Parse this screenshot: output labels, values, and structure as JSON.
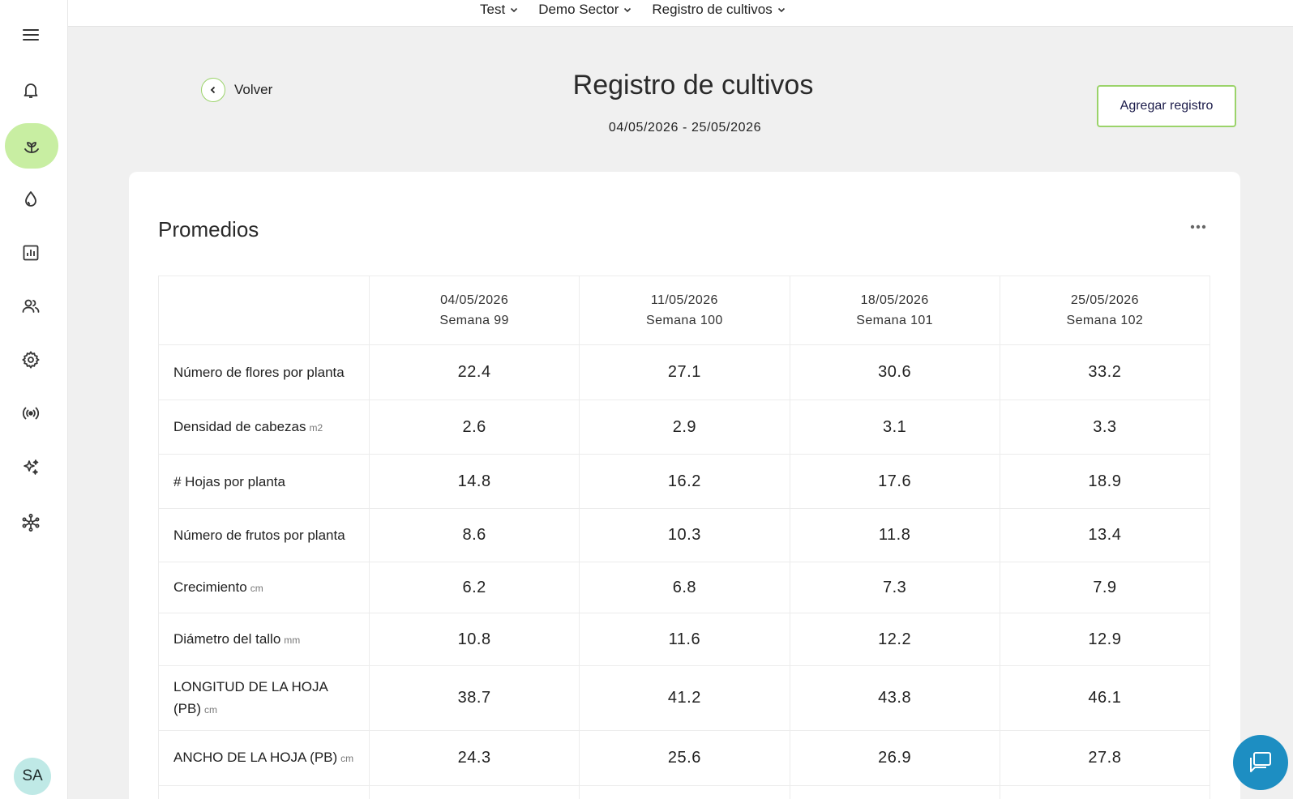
{
  "topbar": {
    "crumbs": [
      {
        "label": "Test"
      },
      {
        "label": "Demo Sector"
      },
      {
        "label": "Registro de cultivos"
      }
    ]
  },
  "sidebar": {
    "items": [
      {
        "icon": "menu-icon"
      },
      {
        "icon": "bell-icon"
      },
      {
        "icon": "plant-icon",
        "active": true
      },
      {
        "icon": "water-drop-icon"
      },
      {
        "icon": "bar-chart-icon"
      },
      {
        "icon": "users-icon"
      },
      {
        "icon": "gear-icon"
      },
      {
        "icon": "signal-icon"
      },
      {
        "icon": "sparkle-icon"
      },
      {
        "icon": "network-icon"
      }
    ],
    "avatar": "SA"
  },
  "header": {
    "back_label": "Volver",
    "title": "Registro de cultivos",
    "date_range": "04/05/2026 - 25/05/2026",
    "add_button": "Agregar registro"
  },
  "card": {
    "title": "Promedios",
    "columns": [
      {
        "date": "04/05/2026",
        "week": "Semana 99"
      },
      {
        "date": "11/05/2026",
        "week": "Semana 100"
      },
      {
        "date": "18/05/2026",
        "week": "Semana 101"
      },
      {
        "date": "25/05/2026",
        "week": "Semana 102"
      }
    ],
    "rows": [
      {
        "label": "Número de flores por planta",
        "unit": "",
        "values": [
          "22.4",
          "27.1",
          "30.6",
          "33.2"
        ]
      },
      {
        "label": "Densidad de cabezas",
        "unit": "m2",
        "values": [
          "2.6",
          "2.9",
          "3.1",
          "3.3"
        ]
      },
      {
        "label": "# Hojas por planta",
        "unit": "",
        "values": [
          "14.8",
          "16.2",
          "17.6",
          "18.9"
        ]
      },
      {
        "label": "Número de frutos por planta",
        "unit": "",
        "values": [
          "8.6",
          "10.3",
          "11.8",
          "13.4"
        ]
      },
      {
        "label": "Crecimiento",
        "unit": "cm",
        "values": [
          "6.2",
          "6.8",
          "7.3",
          "7.9"
        ]
      },
      {
        "label": "Diámetro del tallo",
        "unit": "mm",
        "values": [
          "10.8",
          "11.6",
          "12.2",
          "12.9"
        ]
      },
      {
        "label": "LONGITUD DE LA HOJA (PB)",
        "unit": "cm",
        "values": [
          "38.7",
          "41.2",
          "43.8",
          "46.1"
        ]
      },
      {
        "label": "ANCHO DE LA HOJA (PB)",
        "unit": "cm",
        "values": [
          "24.3",
          "25.6",
          "26.9",
          "27.8"
        ]
      }
    ]
  },
  "colors": {
    "accent_green": "#9bd36a",
    "active_bg": "#c8eea2",
    "chat_blue": "#1d8ec2",
    "avatar_bg": "#bfe9e6"
  }
}
